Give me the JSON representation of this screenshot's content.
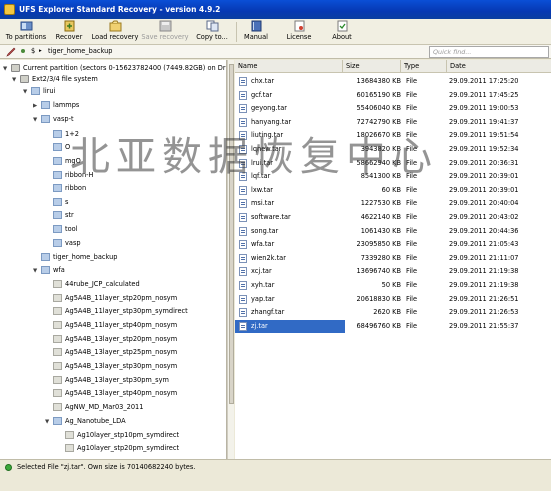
{
  "window": {
    "title": "UFS Explorer Standard Recovery - version 4.9.2"
  },
  "toolbar": {
    "buttons": [
      {
        "label": "To partitions"
      },
      {
        "label": "Recover"
      },
      {
        "label": "Load recovery"
      },
      {
        "label": "Save recovery"
      },
      {
        "label": "Copy to..."
      },
      {
        "label": "Manual"
      },
      {
        "label": "License"
      },
      {
        "label": "About"
      }
    ]
  },
  "pathbar": {
    "root_symbol": "$",
    "current": "tiger_home_backup",
    "quick_find_placeholder": "Quick find..."
  },
  "tree": [
    {
      "label": "Current partition (sectors 0-15623782400 (7449.82GB) on Drive5:"
    },
    {
      "label": "Ext2/3/4 file system"
    },
    {
      "label": "lirui"
    },
    {
      "label": "lammps"
    },
    {
      "label": "vasp-t"
    },
    {
      "label": "1+2"
    },
    {
      "label": "O"
    },
    {
      "label": "mgO"
    },
    {
      "label": "ribbon-H"
    },
    {
      "label": "ribbon"
    },
    {
      "label": "s"
    },
    {
      "label": "str"
    },
    {
      "label": "tool"
    },
    {
      "label": "vasp"
    },
    {
      "label": "tiger_home_backup"
    },
    {
      "label": "wfa"
    },
    {
      "label": "44rube_JCP_calculated"
    },
    {
      "label": "Ag5A4B_11layer_stp20pm_nosym"
    },
    {
      "label": "Ag5A4B_11layer_stp30pm_symdirect"
    },
    {
      "label": "Ag5A4B_11layer_stp40pm_nosym"
    },
    {
      "label": "Ag5A4B_13layer_stp20pm_nosym"
    },
    {
      "label": "Ag5A4B_13layer_stp25pm_nosym"
    },
    {
      "label": "Ag5A4B_13layer_stp30pm_nosym"
    },
    {
      "label": "Ag5A4B_13layer_stp30pm_sym"
    },
    {
      "label": "Ag5A4B_13layer_stp40pm_nosym"
    },
    {
      "label": "AgNW_MD_Mar03_2011"
    },
    {
      "label": "Ag_Nanotube_LDA"
    },
    {
      "label": "Ag10layer_stp10pm_symdirect"
    },
    {
      "label": "Ag10layer_stp20pm_symdirect"
    }
  ],
  "file_list": {
    "columns": [
      "Name",
      "Size",
      "Type",
      "Date"
    ],
    "rows": [
      {
        "name": "chx.tar",
        "size": "13684380 KB",
        "type": "File",
        "date": "29.09.2011 17:25:20"
      },
      {
        "name": "gcf.tar",
        "size": "60165190 KB",
        "type": "File",
        "date": "29.09.2011 17:45:25"
      },
      {
        "name": "geyong.tar",
        "size": "55406040 KB",
        "type": "File",
        "date": "29.09.2011 19:00:53"
      },
      {
        "name": "hanyang.tar",
        "size": "72742790 KB",
        "type": "File",
        "date": "29.09.2011 19:41:37"
      },
      {
        "name": "liuting.tar",
        "size": "18026670 KB",
        "type": "File",
        "date": "29.09.2011 19:51:54"
      },
      {
        "name": "lqnew.tar",
        "size": "3943820 KB",
        "type": "File",
        "date": "29.09.2011 19:52:34"
      },
      {
        "name": "lrui.tar",
        "size": "58662940 KB",
        "type": "File",
        "date": "29.09.2011 20:36:31"
      },
      {
        "name": "lqf.tar",
        "size": "8541300 KB",
        "type": "File",
        "date": "29.09.2011 20:39:01"
      },
      {
        "name": "lxw.tar",
        "size": "60 KB",
        "type": "File",
        "date": "29.09.2011 20:39:01"
      },
      {
        "name": "msi.tar",
        "size": "1227530 KB",
        "type": "File",
        "date": "29.09.2011 20:40:04"
      },
      {
        "name": "software.tar",
        "size": "4622140 KB",
        "type": "File",
        "date": "29.09.2011 20:43:02"
      },
      {
        "name": "song.tar",
        "size": "1061430 KB",
        "type": "File",
        "date": "29.09.2011 20:44:36"
      },
      {
        "name": "wfa.tar",
        "size": "23095850 KB",
        "type": "File",
        "date": "29.09.2011 21:05:43"
      },
      {
        "name": "wien2k.tar",
        "size": "7339280 KB",
        "type": "File",
        "date": "29.09.2011 21:11:07"
      },
      {
        "name": "xcj.tar",
        "size": "13696740 KB",
        "type": "File",
        "date": "29.09.2011 21:19:38"
      },
      {
        "name": "xyh.tar",
        "size": "50 KB",
        "type": "File",
        "date": "29.09.2011 21:19:38"
      },
      {
        "name": "yap.tar",
        "size": "20618830 KB",
        "type": "File",
        "date": "29.09.2011 21:26:51"
      },
      {
        "name": "zhangf.tar",
        "size": "2620 KB",
        "type": "File",
        "date": "29.09.2011 21:26:53"
      },
      {
        "name": "zj.tar",
        "size": "68496760 KB",
        "type": "File",
        "date": "29.09.2011 21:55:37"
      }
    ]
  },
  "status": {
    "text": "Selected File \"zj.tar\". Own size is 70140682240 bytes."
  },
  "watermark": {
    "text": "北亚数据恢复中心"
  },
  "colors": {
    "selection": "#316ac5",
    "titlebar": "#0a4fd6"
  }
}
